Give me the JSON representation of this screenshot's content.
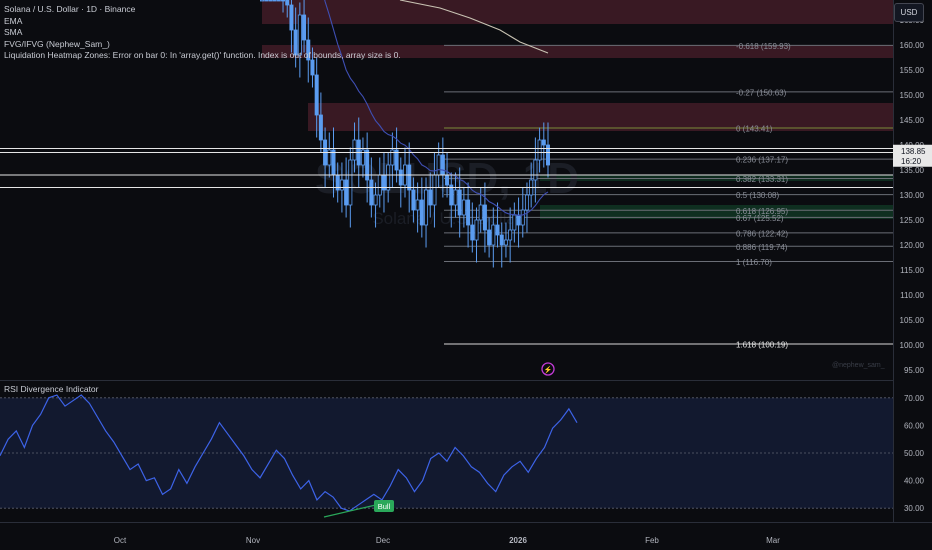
{
  "legend": {
    "symbol_line": "Solana / U.S. Dollar · 1D · Binance",
    "ema": "EMA",
    "sma": "SMA",
    "fvg": "FVG/IFVG (Nephew_Sam_)",
    "heatmap": "Liquidation Heatmap Zones: Error on bar 0: In 'array.get()' function. Index is out of bounds, array size is 0."
  },
  "currency_button": "USD",
  "watermark": {
    "symbol": "SOLUSD, 1D",
    "name": "Solana / U.S. Dollar"
  },
  "credit": "@nephew_sam_",
  "indicator_title": "RSI Divergence Indicator",
  "price_axis": {
    "ticks": [
      "165.00",
      "160.00",
      "155.00",
      "150.00",
      "145.00",
      "140.00",
      "135.00",
      "130.00",
      "125.00",
      "120.00",
      "115.00",
      "110.00",
      "105.00",
      "100.00",
      "95.00"
    ],
    "current_price": "138.85",
    "countdown": "16:20"
  },
  "rsi_axis": {
    "ticks": [
      "70.00",
      "60.00",
      "50.00",
      "40.00",
      "30.00"
    ]
  },
  "time_axis": {
    "labels": [
      "Oct",
      "Nov",
      "Dec",
      "2026",
      "Feb",
      "Mar"
    ]
  },
  "colors": {
    "background": "#0b0c10",
    "candle": "#5b9cf0",
    "ema": "#3f4fb4",
    "sma": "#c9c3b3",
    "supply_zone": "#4a1d2a",
    "demand_zone": "#0f3322",
    "rsi_line": "#3d63e8",
    "rsi_band": "#131b33",
    "bull_label": "#2aa85a"
  },
  "chart_data": {
    "type": "candlestick",
    "title": "Solana / U.S. Dollar · 1D · Binance",
    "yrange": [
      93,
      169
    ],
    "fib_levels": [
      {
        "label": "-0.618 (159.93)",
        "price": 159.93
      },
      {
        "label": "-0.27 (150.63)",
        "price": 150.63
      },
      {
        "label": "0 (143.41)",
        "price": 143.41
      },
      {
        "label": "0.236 (137.17)",
        "price": 137.17
      },
      {
        "label": "0.382 (133.31)",
        "price": 133.31
      },
      {
        "label": "0.5 (130.08)",
        "price": 130.08
      },
      {
        "label": "0.618 (126.95)",
        "price": 126.95
      },
      {
        "label": "0.67 (125.52)",
        "price": 125.52
      },
      {
        "label": "0.786 (122.42)",
        "price": 122.42
      },
      {
        "label": "0.886 (119.74)",
        "price": 119.74
      },
      {
        "label": "1 (116.70)",
        "price": 116.7
      },
      {
        "label": "1.618 (100.19)",
        "price": 100.19
      }
    ],
    "close_series": [
      202,
      198,
      192,
      184,
      176,
      171,
      168,
      163,
      158,
      166,
      161,
      157,
      154,
      146,
      141,
      136,
      139,
      134,
      131,
      133,
      128,
      137,
      141,
      136,
      139,
      133,
      128,
      130,
      134,
      131,
      136,
      139,
      135,
      132,
      136,
      131,
      127,
      129,
      124,
      131,
      128,
      134,
      138,
      134,
      132,
      128,
      131,
      126,
      129,
      124,
      121,
      125,
      128,
      123,
      120,
      124,
      122,
      120,
      121,
      123,
      126,
      124,
      127,
      130,
      133,
      137,
      141,
      140,
      136
    ],
    "rsi": {
      "range": [
        25,
        75
      ],
      "levels": [
        70,
        50,
        30
      ],
      "bull_label": "Bull",
      "values": [
        49,
        55,
        58,
        52,
        60,
        64,
        70,
        71,
        67,
        69,
        71,
        68,
        63,
        58,
        54,
        49,
        44,
        46,
        40,
        41,
        35,
        37,
        44,
        39,
        45,
        50,
        55,
        61,
        57,
        53,
        49,
        44,
        41,
        46,
        51,
        48,
        42,
        37,
        40,
        33,
        36,
        34,
        30,
        29,
        31,
        33,
        35,
        33,
        38,
        44,
        41,
        36,
        40,
        48,
        50,
        47,
        52,
        49,
        45,
        43,
        39,
        36,
        42,
        45,
        47,
        43,
        48,
        52,
        59,
        62,
        66,
        61
      ]
    }
  }
}
